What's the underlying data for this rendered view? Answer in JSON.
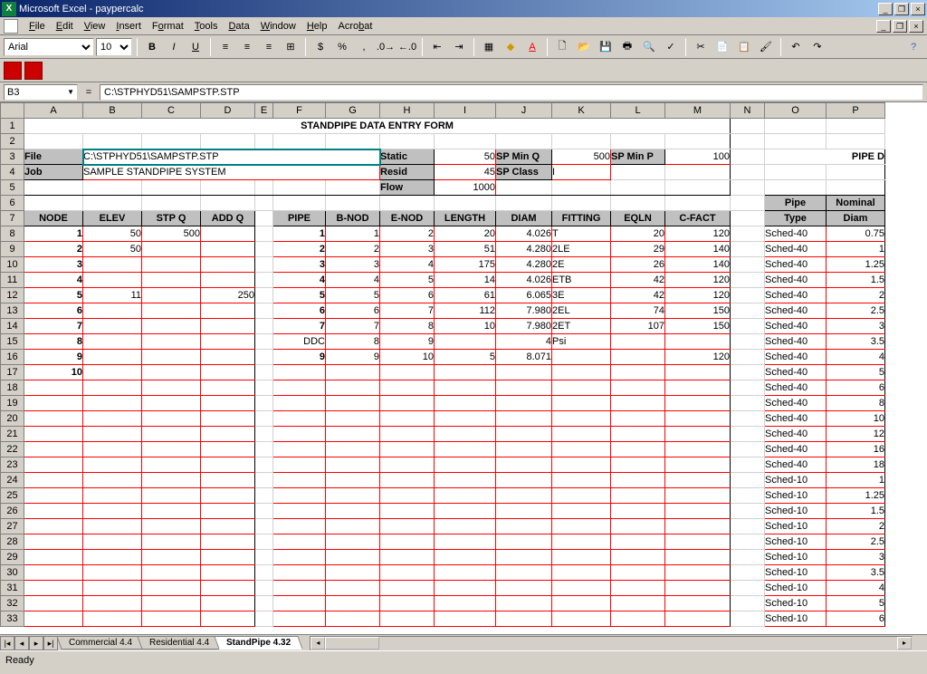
{
  "app": {
    "title": "Microsoft Excel - paypercalc",
    "status": "Ready"
  },
  "menu": [
    "File",
    "Edit",
    "View",
    "Insert",
    "Format",
    "Tools",
    "Data",
    "Window",
    "Help",
    "Acrobat"
  ],
  "toolbar": {
    "font": "Arial",
    "size": "10"
  },
  "namebox": "B3",
  "formula": "C:\\STPHYD51\\SAMPSTP.STP",
  "tabs": {
    "items": [
      "Commercial 4.4",
      "Residential 4.4",
      "StandPipe 4.32"
    ],
    "active": 2
  },
  "columns": [
    "A",
    "B",
    "C",
    "D",
    "E",
    "F",
    "G",
    "H",
    "I",
    "J",
    "K",
    "L",
    "M",
    "N",
    "O",
    "P"
  ],
  "form": {
    "title": "STANDPIPE DATA ENTRY FORM",
    "file_label": "File",
    "file_value": "C:\\STPHYD51\\SAMPSTP.STP",
    "job_label": "Job",
    "job_value": "SAMPLE STANDPIPE SYSTEM",
    "static_label": "Static",
    "static_value": "50",
    "resid_label": "Resid",
    "resid_value": "45",
    "flow_label": "Flow",
    "flow_value": "1000",
    "spminq_label": "SP Min Q",
    "spminq_value": "500",
    "spclass_label": "SP Class",
    "spclass_value": "I",
    "spminp_label": "SP Min P",
    "spminp_value": "100",
    "piped_label": "PIPE D"
  },
  "left_headers": [
    "NODE",
    "ELEV",
    "STP Q",
    "ADD Q"
  ],
  "mid_headers": [
    "PIPE",
    "B-NOD",
    "E-NOD",
    "LENGTH",
    "DIAM",
    "FITTING",
    "EQLN",
    "C-FACT"
  ],
  "right_headers": [
    "Pipe",
    "Nominal",
    "Type",
    "Diam"
  ],
  "left_rows": [
    {
      "node": "1",
      "elev": "50",
      "stpq": "500",
      "addq": ""
    },
    {
      "node": "2",
      "elev": "50",
      "stpq": "",
      "addq": ""
    },
    {
      "node": "3",
      "elev": "",
      "stpq": "",
      "addq": ""
    },
    {
      "node": "4",
      "elev": "",
      "stpq": "",
      "addq": ""
    },
    {
      "node": "5",
      "elev": "11",
      "stpq": "",
      "addq": "250"
    },
    {
      "node": "6",
      "elev": "",
      "stpq": "",
      "addq": ""
    },
    {
      "node": "7",
      "elev": "",
      "stpq": "",
      "addq": ""
    },
    {
      "node": "8",
      "elev": "",
      "stpq": "",
      "addq": ""
    },
    {
      "node": "9",
      "elev": "",
      "stpq": "",
      "addq": ""
    },
    {
      "node": "10",
      "elev": "",
      "stpq": "",
      "addq": ""
    }
  ],
  "mid_rows": [
    {
      "pipe": "1",
      "b": "1",
      "e": "2",
      "len": "20",
      "diam": "4.026",
      "fit": "T",
      "eqln": "20",
      "c": "120"
    },
    {
      "pipe": "2",
      "b": "2",
      "e": "3",
      "len": "51",
      "diam": "4.280",
      "fit": "2LE",
      "eqln": "29",
      "c": "140"
    },
    {
      "pipe": "3",
      "b": "3",
      "e": "4",
      "len": "175",
      "diam": "4.280",
      "fit": "2E",
      "eqln": "26",
      "c": "140"
    },
    {
      "pipe": "4",
      "b": "4",
      "e": "5",
      "len": "14",
      "diam": "4.026",
      "fit": "ETB",
      "eqln": "42",
      "c": "120"
    },
    {
      "pipe": "5",
      "b": "5",
      "e": "6",
      "len": "61",
      "diam": "6.065",
      "fit": "3E",
      "eqln": "42",
      "c": "120"
    },
    {
      "pipe": "6",
      "b": "6",
      "e": "7",
      "len": "112",
      "diam": "7.980",
      "fit": "2EL",
      "eqln": "74",
      "c": "150"
    },
    {
      "pipe": "7",
      "b": "7",
      "e": "8",
      "len": "10",
      "diam": "7.980",
      "fit": "2ET",
      "eqln": "107",
      "c": "150"
    },
    {
      "pipe": "DDC",
      "b": "8",
      "e": "9",
      "len": "",
      "diam": "4",
      "fit": "Psi",
      "eqln": "",
      "c": ""
    },
    {
      "pipe": "9",
      "b": "9",
      "e": "10",
      "len": "5",
      "diam": "8.071",
      "fit": "",
      "eqln": "",
      "c": "120"
    }
  ],
  "right_rows": [
    {
      "type": "Sched-40",
      "diam": "0.75"
    },
    {
      "type": "Sched-40",
      "diam": "1"
    },
    {
      "type": "Sched-40",
      "diam": "1.25"
    },
    {
      "type": "Sched-40",
      "diam": "1.5"
    },
    {
      "type": "Sched-40",
      "diam": "2"
    },
    {
      "type": "Sched-40",
      "diam": "2.5"
    },
    {
      "type": "Sched-40",
      "diam": "3"
    },
    {
      "type": "Sched-40",
      "diam": "3.5"
    },
    {
      "type": "Sched-40",
      "diam": "4"
    },
    {
      "type": "Sched-40",
      "diam": "5"
    },
    {
      "type": "Sched-40",
      "diam": "6"
    },
    {
      "type": "Sched-40",
      "diam": "8"
    },
    {
      "type": "Sched-40",
      "diam": "10"
    },
    {
      "type": "Sched-40",
      "diam": "12"
    },
    {
      "type": "Sched-40",
      "diam": "16"
    },
    {
      "type": "Sched-40",
      "diam": "18"
    },
    {
      "type": "Sched-10",
      "diam": "1"
    },
    {
      "type": "Sched-10",
      "diam": "1.25"
    },
    {
      "type": "Sched-10",
      "diam": "1.5"
    },
    {
      "type": "Sched-10",
      "diam": "2"
    },
    {
      "type": "Sched-10",
      "diam": "2.5"
    },
    {
      "type": "Sched-10",
      "diam": "3"
    },
    {
      "type": "Sched-10",
      "diam": "3.5"
    },
    {
      "type": "Sched-10",
      "diam": "4"
    },
    {
      "type": "Sched-10",
      "diam": "5"
    },
    {
      "type": "Sched-10",
      "diam": "6"
    }
  ]
}
